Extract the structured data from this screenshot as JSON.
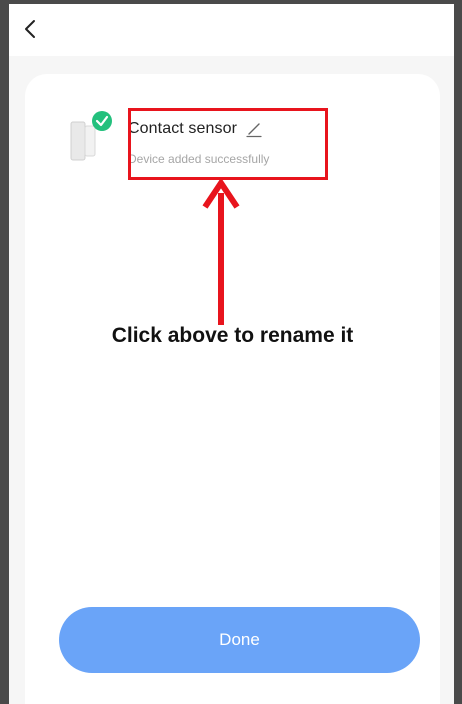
{
  "device": {
    "name": "Contact sensor",
    "status": "Device added successfully",
    "icon": "contact-sensor-icon"
  },
  "annotation": {
    "instruction": "Click above to rename it",
    "highlight_color": "#e8141d"
  },
  "footer": {
    "done_label": "Done"
  },
  "colors": {
    "accent": "#6aa4f8",
    "success": "#23c07d"
  }
}
